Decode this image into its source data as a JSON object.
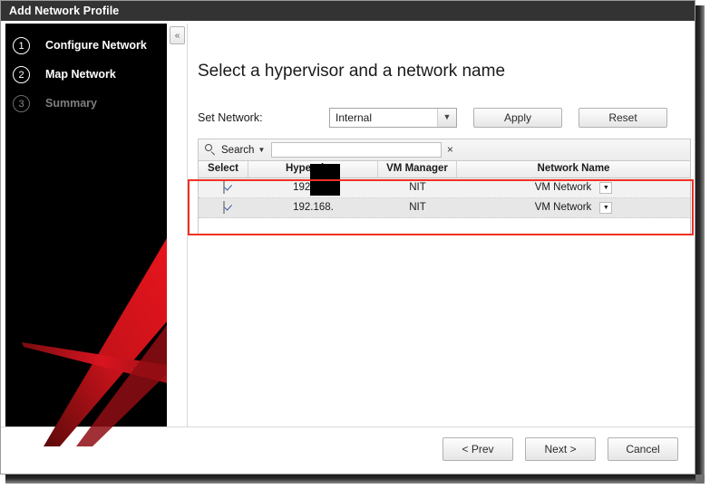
{
  "window": {
    "title": "Add Network Profile"
  },
  "sidebar": {
    "collapse_icon": "chevron-double-left-icon",
    "collapse_glyph": "«",
    "steps": [
      {
        "number": "1",
        "label": "Configure Network",
        "state": "active"
      },
      {
        "number": "2",
        "label": "Map Network",
        "state": "active"
      },
      {
        "number": "3",
        "label": "Summary",
        "state": "inactive"
      }
    ],
    "brand_colors": {
      "background": "#000000",
      "accent_red": "#d0021b",
      "accent_red_dark": "#8c0f12"
    }
  },
  "main": {
    "heading": "Select a hypervisor and a network name",
    "set_network": {
      "label": "Set Network:",
      "selected_value": "Internal",
      "dropdown_icon": "chevron-down-icon",
      "apply_label": "Apply",
      "reset_label": "Reset"
    },
    "search": {
      "icon": "search-icon",
      "label": "Search",
      "caret_icon": "caret-down-icon",
      "value": "",
      "placeholder": "",
      "clear_icon": "close-icon",
      "clear_glyph": "×"
    },
    "table": {
      "columns": [
        "Select",
        "Hypervisor",
        "VM Manager",
        "Network Name"
      ],
      "rows": [
        {
          "selected": true,
          "hypervisor": "192.168.",
          "hypervisor_redacted": true,
          "vm_manager": "NIT",
          "network_name": "VM Network",
          "network_dropdown_icon": "caret-down-icon"
        },
        {
          "selected": true,
          "hypervisor": "192.168.",
          "hypervisor_redacted": true,
          "vm_manager": "NIT",
          "network_name": "VM Network",
          "network_dropdown_icon": "caret-down-icon"
        }
      ]
    },
    "annotation": {
      "type": "highlight-rectangle",
      "color": "#ee3124"
    }
  },
  "footer": {
    "prev_label": "< Prev",
    "next_label": "Next >",
    "cancel_label": "Cancel"
  }
}
